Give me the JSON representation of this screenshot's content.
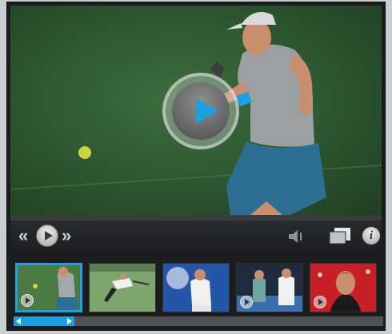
{
  "player": {
    "icons": {
      "play": "play-icon",
      "rewind": "rewind-icon",
      "forward": "fast-forward-icon",
      "volume": "volume-icon",
      "fullscreen": "fullscreen-icon",
      "info": "info-icon"
    },
    "controls": {
      "rewind_glyph": "«",
      "forward_glyph": "»",
      "info_glyph": "i"
    },
    "accent_color": "#1ba1e2"
  },
  "thumbnails": [
    {
      "scene": "player-forehand",
      "active": true
    },
    {
      "scene": "player-lunge",
      "active": false
    },
    {
      "scene": "player-blue-court",
      "active": false
    },
    {
      "scene": "players-net",
      "active": false
    },
    {
      "scene": "player-interview",
      "active": false
    }
  ]
}
